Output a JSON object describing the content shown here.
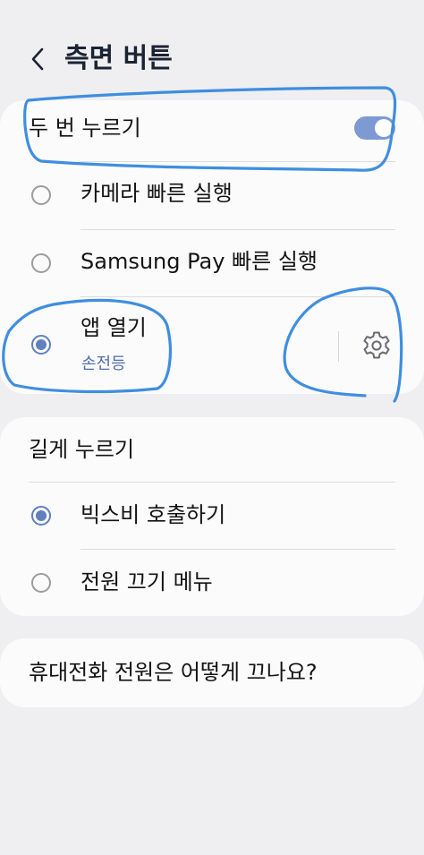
{
  "header": {
    "title": "측면 버튼",
    "back_icon": "chevron-left-icon"
  },
  "double_press": {
    "label": "두 번 누르기",
    "toggle_on": true,
    "options": [
      {
        "label": "카메라 빠른 실행",
        "selected": false
      },
      {
        "label": "Samsung Pay 빠른 실행",
        "selected": false
      },
      {
        "label": "앱 열기",
        "sublabel": "손전등",
        "selected": true,
        "settings_icon": "gear-icon"
      }
    ]
  },
  "press_and_hold": {
    "label": "길게 누르기",
    "options": [
      {
        "label": "빅스비 호출하기",
        "selected": true
      },
      {
        "label": "전원 끄기 메뉴",
        "selected": false
      }
    ]
  },
  "help": {
    "label": "휴대전화 전원은 어떻게 끄나요?"
  },
  "colors": {
    "background": "#efeff1",
    "card": "#fbfbfc",
    "accent": "#5f7fbf",
    "toggle": "#7d9ad3",
    "annotation": "#3f8ee0"
  }
}
